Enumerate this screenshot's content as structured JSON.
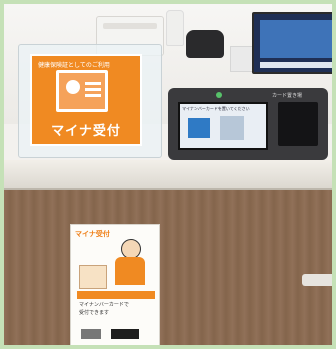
{
  "scene": {
    "counter_sign": {
      "small_text": "健康保険証としてのご利用",
      "main_text": "マイナ受付",
      "icon": "id-card-icon"
    },
    "reader": {
      "screen_text": "マイナンバーカードを置いてください",
      "slot_label": "カード置き場"
    },
    "poster": {
      "title": "マイナ受付",
      "line1": "マイナンバーカードで",
      "line2": "受付できます"
    }
  },
  "colors": {
    "border": "#c5e1b7",
    "sign_orange": "#f08a22",
    "cabinet_wood": "#8b6a50"
  }
}
